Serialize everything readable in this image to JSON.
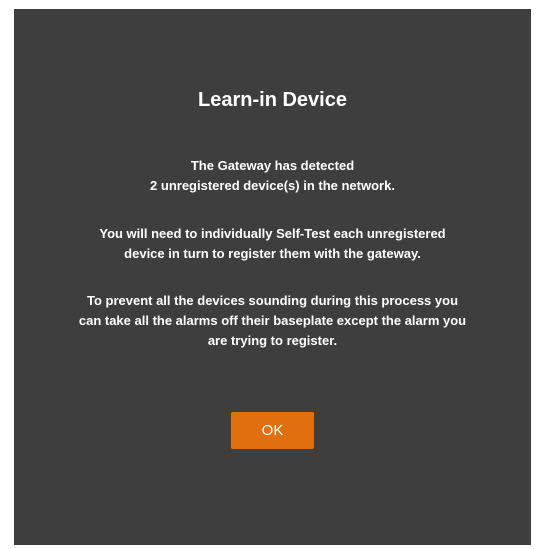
{
  "dialog": {
    "title": "Learn-in Device",
    "paragraphs": [
      {
        "lines": [
          "The Gateway has detected",
          "2 unregistered device(s) in the network."
        ]
      },
      {
        "lines": [
          "You will need to individually Self-Test each unregistered",
          "device in turn to register them with the gateway."
        ]
      },
      {
        "lines": [
          "To prevent all the devices sounding during this process you",
          "can take all the alarms off their baseplate except the alarm you",
          "are trying to register."
        ]
      }
    ],
    "ok_label": "OK"
  },
  "colors": {
    "background": "#3e3e3e",
    "text": "#ffffff",
    "accent": "#e0700e"
  }
}
